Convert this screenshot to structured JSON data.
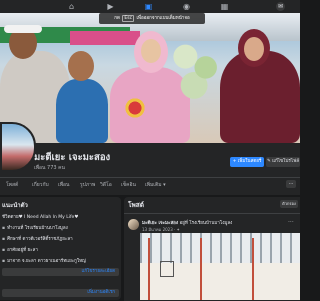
{
  "topnav": {
    "icons": [
      "home-icon",
      "watch-icon",
      "marketplace-icon",
      "groups-icon",
      "gaming-icon",
      "messenger-icon"
    ]
  },
  "tooltip": {
    "before": "กด",
    "key": "Esc",
    "after": "เพื่อออกจากแบบเต็มหน้าจอ"
  },
  "profile": {
    "name": "มะตีเยะ เจะมะสอง",
    "friends": "เพื่อน 773 คน",
    "add_story_label": "เพิ่มในสตอรี่",
    "edit_profile_label": "แก้ไขโปรไฟล์"
  },
  "tabs": {
    "items": [
      "โพสต์",
      "เกี่ยวกับ",
      "เพื่อน",
      "รูปภาพ",
      "วิดีโอ",
      "เช็คอิน",
      "เพิ่มเติม ▾"
    ],
    "more": "···"
  },
  "intro": {
    "title": "แนะนำตัว",
    "lines": [
      "ชีวิตตาย♥ I Need Allah In My Life♥",
      "ทำงานที่ โรงเรียนบ้านบาโงมูลง",
      "ศึกษาที่ ดาวดีเวอร์สิตี้ราชภัฏยะลา",
      "อาศัยอยู่ที่ ยะลา",
      "มาจาก จ.ยะลา ดาวธาเนอาร์ทแยะกูใหญ่"
    ],
    "edit_details_label": "แก้ไขรายละเอียด",
    "add_hobbies_label": "เพิ่มงานอดิเรก"
  },
  "posts": {
    "title": "โพสต์",
    "filter_label": "ตัวกรอง",
    "post": {
      "author": "มะตีเยะ เจะมะสอง",
      "action": "อยู่ที่ โรงเรียนบ้านบาโงมูลง",
      "date": "13 มีนาคม 2023 · ✦",
      "more": "···"
    }
  }
}
